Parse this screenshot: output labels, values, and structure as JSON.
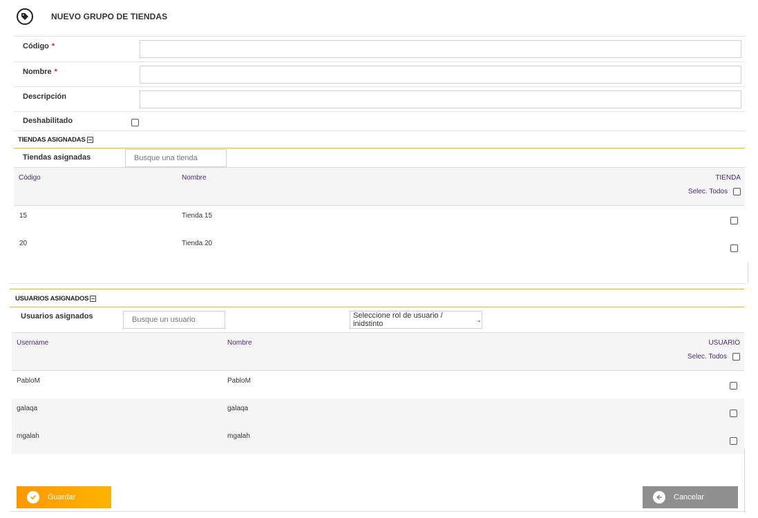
{
  "page": {
    "title": "NUEVO GRUPO DE TIENDAS",
    "title_icon": "tag-icon"
  },
  "form": {
    "codigo": {
      "label": "Código",
      "required_mark": "*",
      "value": ""
    },
    "nombre": {
      "label": "Nombre",
      "required_mark": "*",
      "value": ""
    },
    "descripcion": {
      "label": "Descripción",
      "value": ""
    },
    "deshabilitado": {
      "label": "Deshabilitado",
      "checked": false
    }
  },
  "tiendas": {
    "section_title": "TIENDAS ASIGNADAS",
    "filter_label": "Tiendas asignadas",
    "search_placeholder": "Busque una tienda",
    "columns": {
      "codigo": "Código",
      "nombre": "Nombre",
      "tienda": "TIENDA"
    },
    "select_all": "Selec. Todos",
    "rows": [
      {
        "codigo": "15",
        "nombre": "Tienda 15",
        "checked": false
      },
      {
        "codigo": "20",
        "nombre": "Tienda 20",
        "checked": false
      }
    ]
  },
  "usuarios": {
    "section_title": "USUARIOS ASIGNADOS",
    "filter_label": "Usuarios asignados",
    "search_placeholder": "Busque un usuario",
    "role_select": "Seleccione rol de usuario / inidstinto",
    "columns": {
      "username": "Username",
      "nombre": "Nombre",
      "usuario": "USUARIO"
    },
    "select_all": "Selec. Todos",
    "rows": [
      {
        "username": "PabloM",
        "nombre": "PabloM",
        "checked": false
      },
      {
        "username": "galaqa",
        "nombre": "galaqa",
        "checked": false
      },
      {
        "username": "mgalah",
        "nombre": "mgalah",
        "checked": false
      }
    ]
  },
  "actions": {
    "save_label": "Guardar",
    "cancel_label": "Cancelar"
  },
  "colors": {
    "accent": "#ffa500",
    "section_line": "#f5b700",
    "header_text": "#4a2a6e",
    "cancel_bg": "#8f8f8f"
  }
}
